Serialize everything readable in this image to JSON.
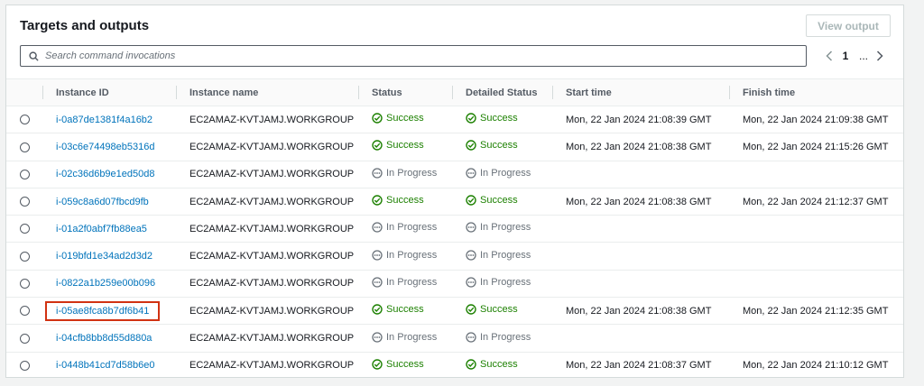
{
  "panel": {
    "title": "Targets and outputs",
    "view_output_label": "View output",
    "search_placeholder": "Search command invocations",
    "pager": {
      "current_page": "1",
      "ellipsis": "..."
    }
  },
  "columns": [
    "Instance ID",
    "Instance name",
    "Status",
    "Detailed Status",
    "Start time",
    "Finish time"
  ],
  "rows": [
    {
      "id": "i-0a87de1381f4a16b2",
      "name": "EC2AMAZ-KVTJAMJ.WORKGROUP",
      "status": "Success",
      "detailed": "Success",
      "start": "Mon, 22 Jan 2024 21:08:39 GMT",
      "finish": "Mon, 22 Jan 2024 21:09:38 GMT"
    },
    {
      "id": "i-03c6e74498eb5316d",
      "name": "EC2AMAZ-KVTJAMJ.WORKGROUP",
      "status": "Success",
      "detailed": "Success",
      "start": "Mon, 22 Jan 2024 21:08:38 GMT",
      "finish": "Mon, 22 Jan 2024 21:15:26 GMT"
    },
    {
      "id": "i-02c36d6b9e1ed50d8",
      "name": "EC2AMAZ-KVTJAMJ.WORKGROUP",
      "status": "In Progress",
      "detailed": "In Progress",
      "start": "",
      "finish": ""
    },
    {
      "id": "i-059c8a6d07fbcd9fb",
      "name": "EC2AMAZ-KVTJAMJ.WORKGROUP",
      "status": "Success",
      "detailed": "Success",
      "start": "Mon, 22 Jan 2024 21:08:38 GMT",
      "finish": "Mon, 22 Jan 2024 21:12:37 GMT"
    },
    {
      "id": "i-01a2f0abf7fb88ea5",
      "name": "EC2AMAZ-KVTJAMJ.WORKGROUP",
      "status": "In Progress",
      "detailed": "In Progress",
      "start": "",
      "finish": ""
    },
    {
      "id": "i-019bfd1e34ad2d3d2",
      "name": "EC2AMAZ-KVTJAMJ.WORKGROUP",
      "status": "In Progress",
      "detailed": "In Progress",
      "start": "",
      "finish": ""
    },
    {
      "id": "i-0822a1b259e00b096",
      "name": "EC2AMAZ-KVTJAMJ.WORKGROUP",
      "status": "In Progress",
      "detailed": "In Progress",
      "start": "",
      "finish": ""
    },
    {
      "id": "i-05ae8fca8b7df6b41",
      "name": "EC2AMAZ-KVTJAMJ.WORKGROUP",
      "status": "Success",
      "detailed": "Success",
      "start": "Mon, 22 Jan 2024 21:08:38 GMT",
      "finish": "Mon, 22 Jan 2024 21:12:35 GMT",
      "highlighted": true
    },
    {
      "id": "i-04cfb8bb8d55d880a",
      "name": "EC2AMAZ-KVTJAMJ.WORKGROUP",
      "status": "In Progress",
      "detailed": "In Progress",
      "start": "",
      "finish": ""
    },
    {
      "id": "i-0448b41cd7d58b6e0",
      "name": "EC2AMAZ-KVTJAMJ.WORKGROUP",
      "status": "Success",
      "detailed": "Success",
      "start": "Mon, 22 Jan 2024 21:08:37 GMT",
      "finish": "Mon, 22 Jan 2024 21:10:12 GMT"
    }
  ],
  "colors": {
    "link": "#0073bb",
    "success": "#1d8102",
    "in_progress": "#687078",
    "highlight_border": "#d13212"
  },
  "icons": {
    "search": "search-icon",
    "success": "check-circle-icon",
    "in_progress": "pending-circle-icon",
    "prev": "chevron-left-icon",
    "next": "chevron-right-icon"
  }
}
